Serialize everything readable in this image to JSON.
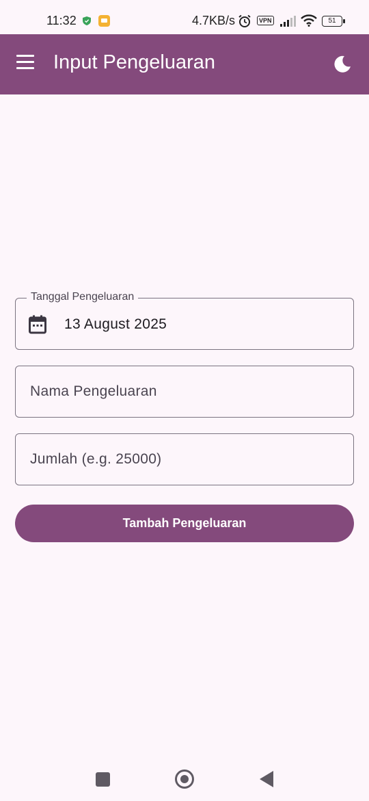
{
  "status_bar": {
    "time": "11:32",
    "network_speed": "4.7KB/s",
    "vpn_label": "VPN",
    "battery_level": "51",
    "icons": [
      "shield-icon",
      "notification-icon",
      "alarm-icon",
      "signal-icon",
      "wifi-icon",
      "battery-icon"
    ]
  },
  "app_bar": {
    "title": "Input Pengeluaran",
    "menu_icon": "hamburger-menu-icon",
    "theme_icon": "moon-icon",
    "color": "#844a7c"
  },
  "form": {
    "date_field": {
      "label": "Tanggal Pengeluaran",
      "value": "13 August 2025",
      "icon": "calendar-icon"
    },
    "name_field": {
      "placeholder": "Nama Pengeluaran",
      "value": ""
    },
    "amount_field": {
      "placeholder": "Jumlah (e.g. 25000)",
      "value": ""
    },
    "submit_label": "Tambah Pengeluaran"
  },
  "nav_bar": {
    "icons": [
      "recent-apps-icon",
      "home-icon",
      "back-icon"
    ]
  },
  "colors": {
    "primary": "#844a7c",
    "background": "#fdf6fb",
    "outline": "#7a7380"
  }
}
